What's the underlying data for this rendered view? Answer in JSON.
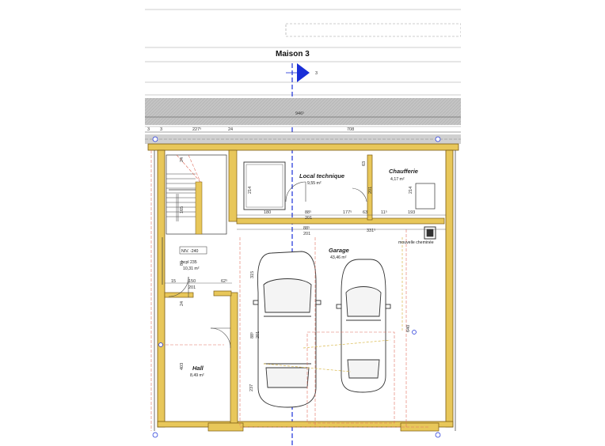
{
  "plan": {
    "title": "Maison 3",
    "section_marker": "3",
    "colors": {
      "wall_fill": "#e8c75a",
      "wall_stroke": "#7a5a10",
      "hatch": "#bdbdbd",
      "marker": "#1a2fd8",
      "guide_red": "#e07060"
    },
    "rooms": [
      {
        "id": "local",
        "name": "Local technique",
        "area": "9,55 m²"
      },
      {
        "id": "chaufferie",
        "name": "Chaufferie",
        "area": "4,17 m²"
      },
      {
        "id": "garage",
        "name": "Garage",
        "area": "43,46 m²"
      },
      {
        "id": "hall",
        "name": "Hall",
        "area": "8,49 m²"
      },
      {
        "id": "wc",
        "name": "",
        "area": "10,31 m²"
      }
    ],
    "level_tag": {
      "label": "NIV. -240",
      "sub": "hcpl 235"
    },
    "notes": {
      "chimney": "mouvelle cheminée"
    },
    "dimensions": {
      "overall": "946⁵",
      "top": [
        "3",
        "3",
        "227⁵",
        "24",
        "708"
      ],
      "local_row": [
        "180",
        "88⁵",
        "201",
        "177⁵",
        "63",
        "11⁵",
        "193"
      ],
      "mid_row": [
        "88⁵",
        "201",
        "331⁵"
      ],
      "hall_row": [
        "150",
        "201",
        "62⁵",
        "15"
      ],
      "verticals": [
        "24",
        "165",
        "315",
        "80",
        "24",
        "403",
        "237",
        "88⁵",
        "201",
        "214",
        "214",
        "63",
        "201",
        "640"
      ]
    }
  }
}
